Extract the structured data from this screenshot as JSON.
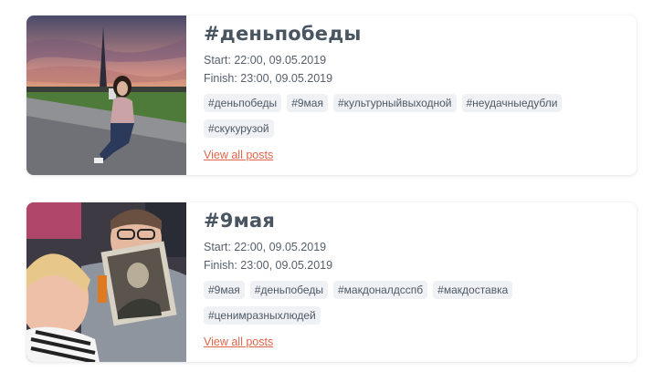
{
  "posts": [
    {
      "title": "#деньпобеды",
      "start": "Start: 22:00, 09.05.2019",
      "finish": "Finish: 23:00, 09.05.2019",
      "tags": [
        "#деньпобеды",
        "#9мая",
        "#культурныйвыходной",
        "#неудачныедубли",
        "#скукурузой"
      ],
      "link": "View all posts"
    },
    {
      "title": "#9мая",
      "start": "Start: 22:00, 09.05.2019",
      "finish": "Finish: 23:00, 09.05.2019",
      "tags": [
        "#9мая",
        "#деньпобеды",
        "#макдоналдсспб",
        "#макдоставка",
        "#ценимразныхлюдей"
      ],
      "link": "View all posts"
    }
  ],
  "colors": {
    "link": "#e0644a",
    "title": "#4a5562",
    "tag_bg": "#eff1f4"
  }
}
